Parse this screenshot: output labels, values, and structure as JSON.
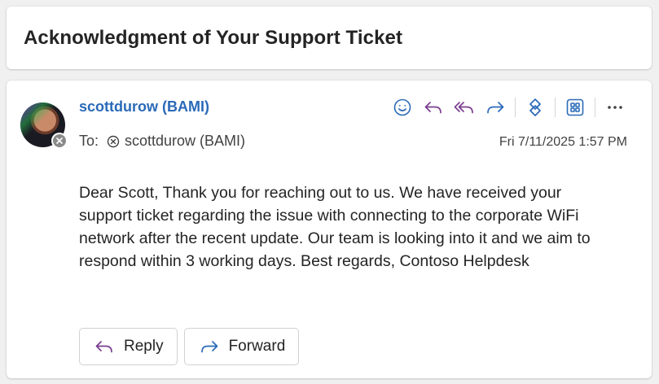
{
  "subject": "Acknowledgment of Your Support Ticket",
  "message": {
    "sender": "scottdurow (BAMI)",
    "to_label": "To:",
    "recipient": "scottdurow (BAMI)",
    "date": "Fri 7/11/2025 1:57 PM",
    "body": "Dear Scott, Thank you for reaching out to us. We have received your support ticket regarding the issue with connecting to the corporate WiFi network after the recent update. Our team is looking into it and we aim to respond within 3 working days. Best regards, Contoso Helpdesk"
  },
  "toolbar": {
    "icons": [
      "emoji-icon",
      "reply-icon",
      "reply-all-icon",
      "forward-icon",
      "loop-icon",
      "apps-icon",
      "more-icon"
    ]
  },
  "actions": {
    "reply_label": "Reply",
    "forward_label": "Forward"
  },
  "colors": {
    "accent": "#2a6ab8",
    "reply_purple": "#7a3d8f",
    "forward_blue": "#2a6ab8"
  }
}
